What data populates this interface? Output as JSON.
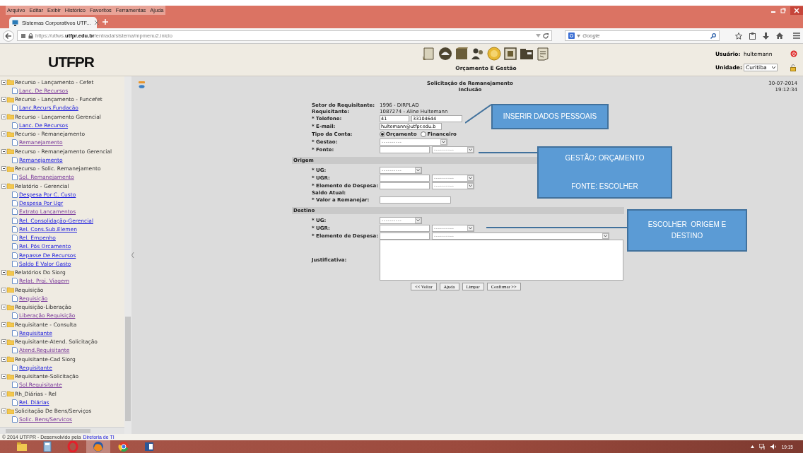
{
  "browser": {
    "menu": [
      "Arquivo",
      "Editar",
      "Exibir",
      "Histórico",
      "Favoritos",
      "Ferramentas",
      "Ajuda"
    ],
    "tab": "Sistemas Corporativos UTF...",
    "url": "https://utfws.**utfpr.edu.br**/entrada/sistema/mpmenu2.inicio",
    "search_placeholder": "Google"
  },
  "header": {
    "logo": "UTFPR",
    "module": "Orçamento E Gestão",
    "user_label": "Usuário:",
    "user": "hultemann",
    "unit_label": "Unidade:",
    "unit": "Curitiba"
  },
  "sidebar": {
    "groups": [
      {
        "label": "Recurso - Lançamento - Cefet",
        "children": [
          {
            "label": "Lanc. De Recursos",
            "visited": true
          }
        ]
      },
      {
        "label": "Recurso - Lançamento - Funcefet",
        "children": [
          {
            "label": "Lanc.Recurs.Fundação",
            "visited": false
          }
        ]
      },
      {
        "label": "Recurso - Lançamento Gerencial",
        "children": [
          {
            "label": "Lanc. De Recursos",
            "visited": false
          }
        ]
      },
      {
        "label": "Recurso - Remanejamento",
        "children": [
          {
            "label": "Remanejamento",
            "visited": true
          }
        ]
      },
      {
        "label": "Recurso - Remanejamento Gerencial",
        "children": [
          {
            "label": "Remanejamento",
            "visited": false
          }
        ]
      },
      {
        "label": "Recurso - Solic. Remanejamento",
        "children": [
          {
            "label": "Sol. Remanejamento",
            "visited": true
          }
        ]
      },
      {
        "label": "Relatório - Gerencial",
        "children": [
          {
            "label": "Despesa Por C. Custo",
            "visited": false
          },
          {
            "label": "Despesa Por Ugr",
            "visited": false
          },
          {
            "label": "Extrato Lançamentos",
            "visited": true
          },
          {
            "label": "Rel. Consolidação-Gerencial",
            "visited": false
          },
          {
            "label": "Rel. Cons.Sub.Elemen",
            "visited": false
          },
          {
            "label": "Rel. Empenho",
            "visited": false
          },
          {
            "label": "Rel. Pós Orcamento",
            "visited": false
          },
          {
            "label": "Repasse De Recursos",
            "visited": false
          },
          {
            "label": "Saldo E Valor Gasto",
            "visited": false
          }
        ]
      },
      {
        "label": "Relatórios Do Siorg",
        "children": [
          {
            "label": "Relat. Proj. Viagem",
            "visited": true
          }
        ]
      },
      {
        "label": "Requisição",
        "children": [
          {
            "label": "Requisição",
            "visited": true
          }
        ]
      },
      {
        "label": "Requisição-Liberação",
        "children": [
          {
            "label": "Liberação Requisição",
            "visited": true
          }
        ]
      },
      {
        "label": "Requisitante - Consulta",
        "children": [
          {
            "label": "Requisitante",
            "visited": false
          }
        ]
      },
      {
        "label": "Requisitante-Atend. Solicitação",
        "children": [
          {
            "label": "Atend.Requisitante",
            "visited": true
          }
        ]
      },
      {
        "label": "Requisitante-Cad Siorg",
        "children": [
          {
            "label": "Requisitante",
            "visited": false
          }
        ]
      },
      {
        "label": "Requisitante-Solicitação",
        "children": [
          {
            "label": "Sol.Requisitante",
            "visited": true
          }
        ]
      },
      {
        "label": "Rh_Diárias - Rel",
        "children": [
          {
            "label": "Rel. Diárias",
            "visited": false
          }
        ]
      },
      {
        "label": "Solicitação De Bens/Serviços",
        "children": [
          {
            "label": "Solic. Bens/Servicos",
            "visited": true
          }
        ]
      }
    ]
  },
  "form": {
    "title": "Solicitação de Remanejamento",
    "subtitle": "Inclusão",
    "date": "30-07-2014",
    "time": "19:12:34",
    "rows": [
      {
        "kind": "info",
        "label": "Setor do Requisitante:",
        "value": "1996 - DIRPLAD"
      },
      {
        "kind": "info",
        "label": "Requisitante:",
        "value": "1087274 - Aline Hultemann"
      },
      {
        "kind": "phone",
        "label": "* Telefone:",
        "values": [
          "41",
          "33104644"
        ]
      },
      {
        "kind": "text",
        "label": "* E-mail:",
        "value": "hultemann@utfpr.edu.b"
      },
      {
        "kind": "radio",
        "label": "Tipo da Conta:",
        "options": [
          {
            "label": "Orçamento",
            "selected": true
          },
          {
            "label": "Financeiro",
            "selected": false
          }
        ]
      },
      {
        "kind": "select",
        "label": "* Gestao:",
        "select": "----------"
      },
      {
        "kind": "text_select",
        "label": "* Fonte:",
        "select": "----------"
      },
      {
        "kind": "section",
        "label": "Origem"
      },
      {
        "kind": "short_select",
        "label": "* UG:",
        "select": "----------"
      },
      {
        "kind": "text_select",
        "label": "* UGR:",
        "select": "----------"
      },
      {
        "kind": "text_select",
        "label": "* Elemento de Despesa:",
        "select": "----------"
      },
      {
        "kind": "info",
        "label": "Saldo Atual:"
      },
      {
        "kind": "long_text",
        "label": "* Valor a Remanejar:"
      },
      {
        "kind": "section",
        "label": "Destino"
      },
      {
        "kind": "short_select",
        "label": "* UG:",
        "select": "----------"
      },
      {
        "kind": "text_select",
        "label": "* UGR:",
        "select": "----------"
      },
      {
        "kind": "wide_select",
        "label": "* Elemento de Despesa:",
        "select": "----------"
      },
      {
        "kind": "textarea",
        "label": "Justificativa:"
      }
    ],
    "buttons": [
      "<< Voltar",
      "Ajuda",
      "Limpar",
      "Confirmar >>"
    ]
  },
  "callouts": [
    {
      "lines": [
        "INSERIR DADOS PESSOAIS"
      ]
    },
    {
      "lines": [
        "GESTÃO: ORÇAMENTO",
        "FONTE: ESCOLHER"
      ]
    },
    {
      "lines": [
        "ESCOLHER  ORIGEM E DESTINO"
      ]
    }
  ],
  "footer": {
    "text": "© 2014 UTFPR - Desenvolvido pela",
    "link": "Diretoria de TI"
  },
  "taskbar": {
    "apps": [
      {
        "kind": "folder",
        "active": false
      },
      {
        "kind": "calculator",
        "active": false
      },
      {
        "kind": "ring",
        "active": false
      },
      {
        "kind": "globe",
        "active": true
      },
      {
        "kind": "circle",
        "active": false
      },
      {
        "kind": "document",
        "active": false
      }
    ],
    "clock": "19:15"
  }
}
